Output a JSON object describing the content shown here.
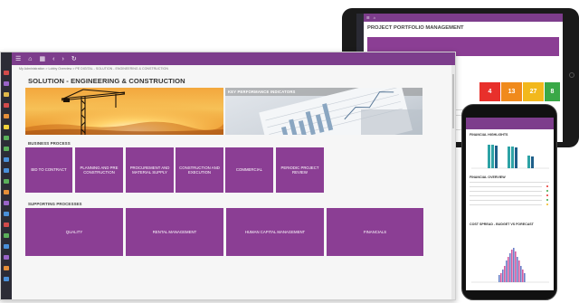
{
  "main": {
    "breadcrumb": "My Administration  >  Lobby Overview  >  PE DIGITAL - SOLUTION - ENGINEERING & CONSTRUCTION",
    "title": "SOLUTION - ENGINEERING & CONSTRUCTION",
    "kpi_banner_label": "KEY PERFORMANCE INDICATORS",
    "business_process_heading": "BUSINESS PROCESS",
    "business_tiles": [
      "BID TO CONTRACT",
      "PLANNING AND PRE CONSTRUCTION",
      "PROCUREMENT AND MATERIAL SUPPLY",
      "CONSTRUCTION AND EXECUTION",
      "COMMERCIAL",
      "PERIODIC PROJECT REVIEW"
    ],
    "supporting_heading": "SUPPORTING PROCESSES",
    "supporting_tiles": [
      "QUALITY",
      "RENTAL MANAGEMENT",
      "HUMAN CAPITAL MANAGEMENT",
      "FINANCIALS"
    ]
  },
  "tablet": {
    "title": "PROJECT PORTFOLIO MANAGEMENT",
    "kpi_values": [
      "4",
      "13",
      "27",
      "8"
    ],
    "kpi_colors": [
      "#e8302b",
      "#f08a1c",
      "#f2b81c",
      "#39a847"
    ]
  },
  "phone": {
    "financial_highlights": "FINANCIAL HIGHLIGHTS",
    "financial_overview": "FINANCIAL OVERVIEW",
    "cost_spread": "COST SPREAD - BUDGET VS FORECAST"
  },
  "colors": {
    "accent": "#7d3d8c",
    "tile": "#8b3e94"
  }
}
